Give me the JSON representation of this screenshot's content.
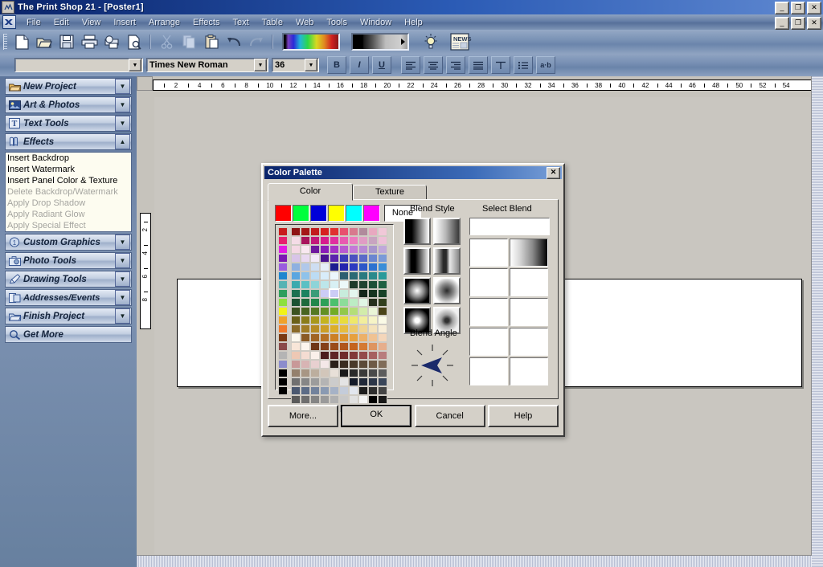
{
  "window": {
    "title": "The Print Shop 21 - [Poster1]",
    "app_icon": "printshop-icon",
    "controls": {
      "minimize": "_",
      "restore": "❐",
      "close": "✕"
    }
  },
  "menubar": {
    "logo": "app-logo-icon",
    "items": [
      "File",
      "Edit",
      "View",
      "Insert",
      "Arrange",
      "Effects",
      "Text",
      "Table",
      "Web",
      "Tools",
      "Window",
      "Help"
    ]
  },
  "toolbar": {
    "buttons": [
      {
        "name": "new-icon",
        "glyph": "new"
      },
      {
        "name": "open-icon",
        "glyph": "open"
      },
      {
        "name": "save-icon",
        "glyph": "save"
      },
      {
        "name": "print-icon",
        "glyph": "print"
      },
      {
        "name": "print-preview-icon",
        "glyph": "preview"
      },
      {
        "name": "find-icon",
        "glyph": "find"
      },
      {
        "name": "cut-icon",
        "glyph": "cut"
      },
      {
        "name": "copy-icon",
        "glyph": "copy"
      },
      {
        "name": "paste-icon",
        "glyph": "paste"
      },
      {
        "name": "undo-icon",
        "glyph": "undo"
      },
      {
        "name": "redo-icon",
        "glyph": "redo"
      }
    ],
    "spectrum_bar": "color-spectrum-bar",
    "gradient_bar": "gradient-bar",
    "tip_icon": "lightbulb-icon",
    "news_icon": "news-icon",
    "news_label": "NEWS"
  },
  "formatbar": {
    "style_value": "",
    "style_placeholder": "",
    "font_value": "Times New Roman",
    "size_value": "36",
    "buttons": [
      {
        "name": "bold-button",
        "label": "B"
      },
      {
        "name": "italic-button",
        "label": "I"
      },
      {
        "name": "underline-button",
        "label": "U"
      },
      {
        "name": "align-left-button",
        "label": "align-left"
      },
      {
        "name": "align-center-button",
        "label": "align-center"
      },
      {
        "name": "align-right-button",
        "label": "align-right"
      },
      {
        "name": "align-justify-button",
        "label": "align-justify"
      },
      {
        "name": "text-frame-button",
        "label": "text-frame"
      },
      {
        "name": "bullets-button",
        "label": "bullets"
      },
      {
        "name": "spacing-button",
        "label": "a·b"
      }
    ]
  },
  "sidebar": {
    "items": [
      {
        "label": "New Project",
        "icon": "folder-icon",
        "expanded": false
      },
      {
        "label": "Art & Photos",
        "icon": "picture-icon",
        "expanded": false
      },
      {
        "label": "Text Tools",
        "icon": "text-t-icon",
        "expanded": false
      },
      {
        "label": "Effects",
        "icon": "effects-icon",
        "expanded": true
      },
      {
        "label": "Custom Graphics",
        "icon": "custom-icon",
        "expanded": false
      },
      {
        "label": "Photo Tools",
        "icon": "camera-icon",
        "expanded": false
      },
      {
        "label": "Drawing Tools",
        "icon": "pencil-icon",
        "expanded": false
      },
      {
        "label": "Addresses/Events",
        "icon": "addresses-icon",
        "expanded": false
      },
      {
        "label": "Finish Project",
        "icon": "finish-icon",
        "expanded": false
      },
      {
        "label": "Get More",
        "icon": "getmore-icon",
        "expanded": null
      }
    ],
    "effects_submenu": [
      {
        "label": "Insert Backdrop",
        "disabled": false
      },
      {
        "label": "Insert Watermark",
        "disabled": false
      },
      {
        "label": "Insert Panel Color & Texture",
        "disabled": false
      },
      {
        "label": "Delete Backdrop/Watermark",
        "disabled": true
      },
      {
        "label": "Apply Drop Shadow",
        "disabled": true
      },
      {
        "label": "Apply Radiant Glow",
        "disabled": true
      },
      {
        "label": "Apply Special Effect",
        "disabled": true
      }
    ]
  },
  "rulers": {
    "horizontal_ticks": [
      2,
      4,
      6,
      8,
      10,
      12,
      14,
      16,
      18,
      20,
      22,
      24,
      26,
      28,
      30,
      32,
      34,
      36,
      38,
      40,
      42,
      44,
      46,
      48,
      50,
      52,
      54
    ],
    "vertical_ticks": [
      2,
      4,
      6,
      8
    ]
  },
  "dialog": {
    "title": "Color Palette",
    "close_label": "✕",
    "tabs": [
      {
        "label": "Color",
        "selected": true
      },
      {
        "label": "Texture",
        "selected": false
      }
    ],
    "basic_colors": [
      "#ff0000",
      "#00ff3c",
      "#0000d8",
      "#ffff00",
      "#00ffff",
      "#ff00ff"
    ],
    "none_label": "None",
    "labels": {
      "blend_style": "Blend Style",
      "select_blend": "Select Blend",
      "blend_angle": "Blend Angle"
    },
    "blend_styles": [
      {
        "name": "linear-dark-light",
        "selected": false
      },
      {
        "name": "linear-light-dark",
        "selected": false
      },
      {
        "name": "linear-mirror-light",
        "selected": false
      },
      {
        "name": "linear-mirror-dark",
        "selected": false
      },
      {
        "name": "radial-light-center",
        "selected": false
      },
      {
        "name": "radial-dark-center",
        "selected": false
      },
      {
        "name": "square-light-center",
        "selected": false
      },
      {
        "name": "square-dark-center",
        "selected": false
      }
    ],
    "select_blend_preview": "",
    "select_blend_slots": [
      {
        "filled": false
      },
      {
        "filled": true
      },
      {
        "filled": false
      },
      {
        "filled": false
      },
      {
        "filled": false
      },
      {
        "filled": false
      },
      {
        "filled": false
      },
      {
        "filled": false
      },
      {
        "filled": false
      },
      {
        "filled": false
      }
    ],
    "blend_angle_value": "0",
    "buttons": [
      {
        "name": "more-button",
        "label": "More...",
        "default": false
      },
      {
        "name": "ok-button",
        "label": "OK",
        "default": true
      },
      {
        "name": "cancel-button",
        "label": "Cancel",
        "default": false
      },
      {
        "name": "help-button",
        "label": "Help",
        "default": false
      }
    ],
    "color_grid": {
      "rows": 19,
      "cols": 11,
      "selected_row": 6,
      "selected_col": 8,
      "selected_color": "#ccccf6",
      "left_column": [
        "#c81c1c",
        "#e6216e",
        "#e21ce2",
        "#7b18b4",
        "#9a5cde",
        "#1e86cf",
        "#56b3b3",
        "#2f9e5c",
        "#8ee03e",
        "#f2f217",
        "#f0a22c",
        "#f07a2c",
        "#7a3a14",
        "#8a4a4a",
        "#b4b4b4",
        "#8c8ccc",
        "#000000",
        "#000000",
        "#000000"
      ],
      "cells": [
        [
          "#8e1414",
          "#a41818",
          "#c21c1c",
          "#d62020",
          "#e03030",
          "#e8506e",
          "#d87a8e",
          "#b08a9c",
          "#e8a8c0",
          "#f0c8d8",
          "#f4dce6"
        ],
        [
          "#a8145c",
          "#c2187a",
          "#d61c8e",
          "#e030a0",
          "#e85ab0",
          "#ec7cbe",
          "#e09cc4",
          "#c8a4c0",
          "#eec0d8",
          "#f4d8e4",
          "#f8e8f0"
        ],
        [
          "#6e189e",
          "#8a1cb8",
          "#a434c6",
          "#b85ad0",
          "#c47ad8",
          "#b88ad4",
          "#a896cc",
          "#c0a8da",
          "#d8c4e8",
          "#e8d8f0",
          "#f2eaf8"
        ],
        [
          "#4a1490",
          "#5a24ae",
          "#3a3ab8",
          "#4a52c0",
          "#5a6ac8",
          "#6a86d0",
          "#7a9ad8",
          "#8eb0e0",
          "#b0c8ea",
          "#cedef2",
          "#e6eef8"
        ],
        [
          "#1c1c90",
          "#2424ae",
          "#2c3ac0",
          "#2c56c8",
          "#2c72d0",
          "#3a8ed8",
          "#5aa6e0",
          "#8ec2ea",
          "#bcdcf4",
          "#d8ecfa",
          "#ecf6fc"
        ],
        [
          "#2c5e70",
          "#2a6a74",
          "#2a7a80",
          "#2a8a8c",
          "#2a9a9a",
          "#3aaaae",
          "#5ac0c4",
          "#8ed4d8",
          "#bce6ea",
          "#d8f0f4",
          "#ecf8fa"
        ],
        [
          "#1e3a2a",
          "#1f4432",
          "#1d5038",
          "#1e6042",
          "#1c7050",
          "#1c8260",
          "#3a9c78",
          "#ccccf6",
          "#9edcc0",
          "#c8ecdc",
          "#e4f6ee"
        ],
        [
          "#14261a",
          "#163420",
          "#184228",
          "#1c5232",
          "#1e6a3c",
          "#20864a",
          "#2ca058",
          "#4cc06e",
          "#8cdc9a",
          "#bcecc4",
          "#e0f6e4"
        ],
        [
          "#26301c",
          "#32401e",
          "#3c5220",
          "#486420",
          "#547822",
          "#629024",
          "#72ac26",
          "#92c84a",
          "#b4de78",
          "#d2ecaa",
          "#eaf6d6"
        ],
        [
          "#4a4418",
          "#6a6018",
          "#8a7c1a",
          "#a8981c",
          "#c4b420",
          "#dcce22",
          "#e8dc3c",
          "#eee868",
          "#f2ee9c",
          "#f6f4c6",
          "#fafae6"
        ],
        [
          "#8a6a28",
          "#a07c26",
          "#b68c24",
          "#cc9e26",
          "#dcae2a",
          "#e6bc3e",
          "#ecc868",
          "#f0d492",
          "#f4e2ba",
          "#f8eed8",
          "#fcf8ee"
        ],
        [
          "#8a5a26",
          "#a06424",
          "#b67024",
          "#cc8026",
          "#dc902a",
          "#e6a03e",
          "#ecb068",
          "#f0c292",
          "#f4d6ba",
          "#f8e6d8",
          "#fcf4ee"
        ],
        [
          "#6e3616",
          "#844018",
          "#9a4c1a",
          "#b0561c",
          "#c4641e",
          "#d47a34",
          "#de9460",
          "#e6ae8c",
          "#eec8b4",
          "#f4dcd2",
          "#faf0ea"
        ],
        [
          "#4c1c1c",
          "#5e2424",
          "#702c2c",
          "#823838",
          "#944a4a",
          "#a66060",
          "#b87c7c",
          "#c89898",
          "#d8b4b4",
          "#e8d0d0",
          "#f4e8e8"
        ],
        [
          "#2a2018",
          "#3a2c20",
          "#4a3a2a",
          "#5c4a38",
          "#6e5a46",
          "#806c58",
          "#94806c",
          "#a89684",
          "#bcae9e",
          "#d2c6ba",
          "#e8e0d8"
        ],
        [
          "#1a1a1a",
          "#2a2a2a",
          "#3a3a3a",
          "#4a4a4a",
          "#5c5c5c",
          "#707070",
          "#868686",
          "#9c9c9c",
          "#b4b4b4",
          "#cccccc",
          "#e4e4e4"
        ],
        [
          "#141a28",
          "#202838",
          "#2c3648",
          "#3a465a",
          "#4a5870",
          "#5c6c86",
          "#72829c",
          "#8a9ab2",
          "#a6b2c6",
          "#c4ccda",
          "#e2e6ee"
        ],
        [
          "#1c1c1c",
          "#2e2e2e",
          "#454545",
          "#5a5a5a",
          "#6e6e6e",
          "#848484",
          "#9a9a9a",
          "#b0b0b0",
          "#c8c8c8",
          "#e0e0e0",
          "#f4f4f4"
        ],
        [
          "#000000",
          "#181818",
          "#303030",
          "#484848",
          "#606060",
          "#787878",
          "#909090",
          "#a8a8a8",
          "#c0c0c0",
          "#dadada",
          "#ffffff"
        ]
      ]
    }
  },
  "colors": {
    "dialog_face": "#d4d0c8",
    "title_blue": "#0a246a",
    "app_bg": "#5b7196",
    "canvas_bg": "#c9c6c0"
  }
}
